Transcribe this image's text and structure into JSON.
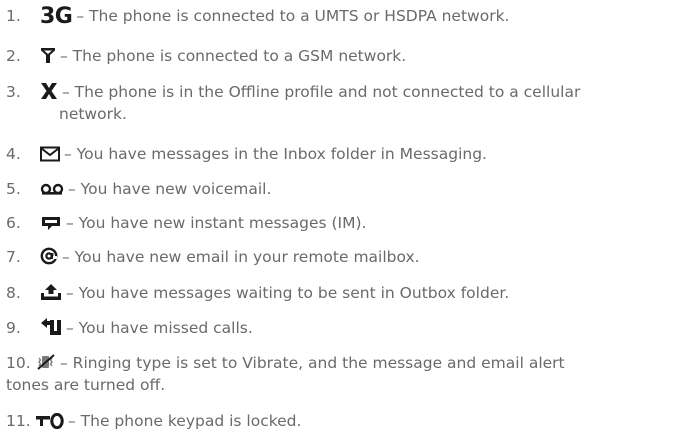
{
  "items": [
    {
      "number": "1.",
      "icon": "3g-icon",
      "icon_text": "3G",
      "text": "– The phone is connected to a UMTS or HSDPA network."
    },
    {
      "number": "2.",
      "icon": "gsm-signal-icon",
      "text": "– The phone is connected to a GSM network."
    },
    {
      "number": "3.",
      "icon": "offline-x-icon",
      "text": "– The phone is in the Offline profile and not connected to a cellular",
      "text_cont": "network."
    },
    {
      "number": "4.",
      "icon": "envelope-icon",
      "text": "– You have messages in the Inbox folder in Messaging."
    },
    {
      "number": "5.",
      "icon": "voicemail-icon",
      "text": "– You have new voicemail."
    },
    {
      "number": "6.",
      "icon": "instant-message-icon",
      "text": "– You have new instant messages (IM)."
    },
    {
      "number": "7.",
      "icon": "at-email-icon",
      "text": "– You have new email in your remote mailbox."
    },
    {
      "number": "8.",
      "icon": "outbox-upload-icon",
      "text": "– You have messages waiting to be sent in Outbox folder."
    },
    {
      "number": "9.",
      "icon": "missed-call-icon",
      "text": "– You have missed calls."
    },
    {
      "number": "10.",
      "icon": "vibrate-silent-icon",
      "text": "– Ringing type is set to Vibrate, and the message and email alert",
      "text_cont": "tones are turned off."
    },
    {
      "number": "11.",
      "icon": "keypad-lock-icon",
      "text": "– The phone keypad is locked."
    }
  ]
}
